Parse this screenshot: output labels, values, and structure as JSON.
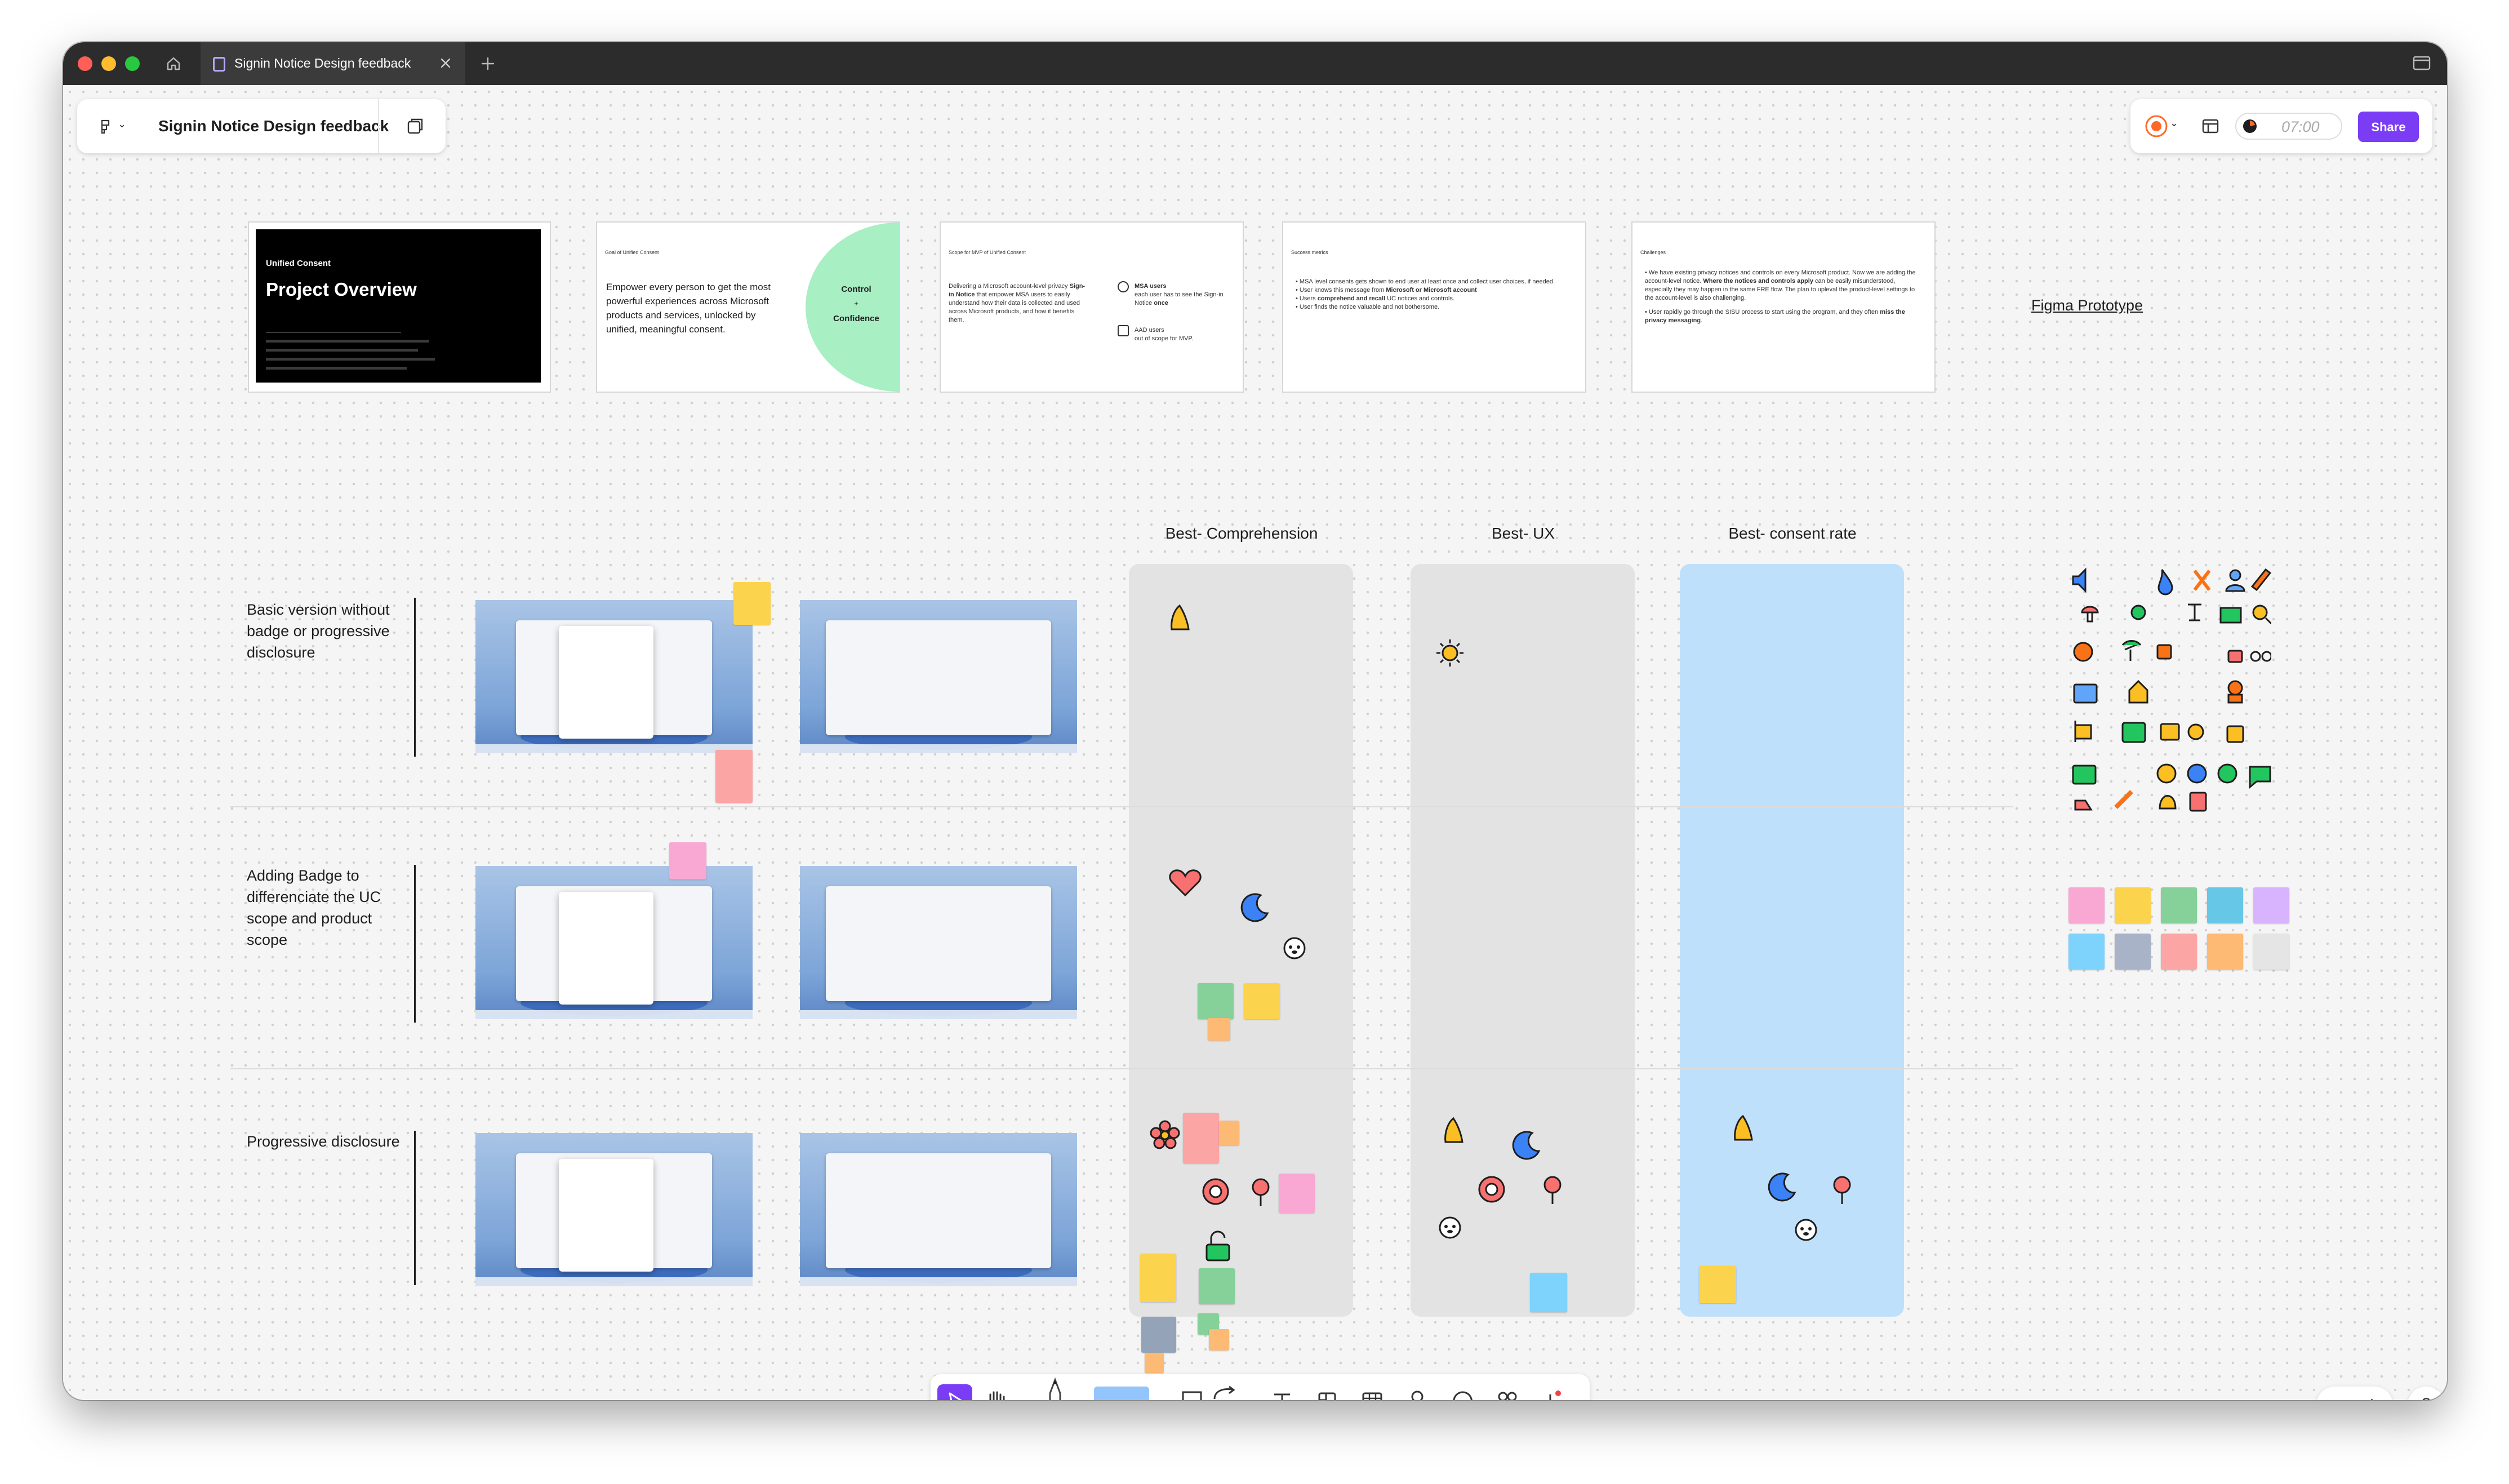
{
  "tab": {
    "title": "Signin Notice Design feedback"
  },
  "file": {
    "name": "Signin Notice Design feedback"
  },
  "header": {
    "timer": "07:00",
    "share_label": "Share"
  },
  "slides": {
    "s1": {
      "eyebrow": "Unified Consent",
      "title": "Project Overview"
    },
    "s2": {
      "heading": "Goal of Unified Consent",
      "body": "Empower every person to get the most powerful experiences across Microsoft products and services, unlocked by unified, meaningful consent.",
      "badge_top": "Control",
      "badge_plus": "+",
      "badge_bottom": "Confidence"
    },
    "s3": {
      "heading": "Scope for MVP of Unified Consent",
      "body_pre": "Delivering a Microsoft account-level privacy ",
      "body_bold": "Sign-in Notice",
      "body_post": " that empower MSA users to easily understand how their data is collected and used across Microsoft products, and how it benefits them.",
      "msa_title": "MSA users",
      "msa_text": "each user has to see the Sign-in Notice",
      "msa_bold": "once",
      "aad_title": "AAD users",
      "aad_text": "out of scope for MVP."
    },
    "s4": {
      "heading": "Success metrics",
      "b1": "MSA level consents gets shown to end user at least once and collect user choices, if needed.",
      "b2_pre": "User knows this message from ",
      "b2_bold": "Microsoft or Microsoft account",
      "b3_pre": "Users ",
      "b3_bold": "comprehend and recall",
      "b3_post": " UC notices and controls.",
      "b4": "User finds the notice valuable and not bothersome."
    },
    "s5": {
      "heading": "Challenges",
      "b1_pre": "We have existing privacy notices and controls on every Microsoft product. Now we are adding the account-level notice. ",
      "b1_bold": "Where the notices and controls apply",
      "b1_post": " can be easily misunderstood, especially they may happen in the same FRE flow. The plan to upleval the product-level settings to the account-level is also challenging.",
      "b2_pre": "User rapidly go through the SISU process to start using the program, and they often ",
      "b2_bold": "miss the privacy messaging",
      "b2_post": "."
    }
  },
  "prototype_link": "Figma Prototype",
  "columns": [
    {
      "label": "Best- Comprehension"
    },
    {
      "label": "Best- UX"
    },
    {
      "label": "Best- consent rate"
    }
  ],
  "rows": [
    {
      "label": "Basic version without badge or progressive disclosure"
    },
    {
      "label": "Adding Badge to differenciate the UC scope and product scope"
    },
    {
      "label": "Progressive disclosure"
    }
  ],
  "colors": {
    "accent": "#7b3cf5",
    "column_grey": "#e3e3e3",
    "column_blue": "#bfe0fb",
    "sticky_yellow": "#fcd34d",
    "sticky_green": "#86d19a",
    "sticky_pink": "#f9a8d4",
    "sticky_red": "#fca5a5",
    "sticky_orange": "#fdba74",
    "sticky_blue": "#7dd3fc",
    "sticky_purple": "#d8b4fe",
    "sticky_gray": "#cbd5e1"
  },
  "toolbar": {
    "tools": [
      "move-tool",
      "hand-tool",
      "pen-tool",
      "sticky-tool",
      "shape-tool",
      "connector-tool",
      "text-tool",
      "section-tool",
      "table-tool",
      "stamp-tool",
      "comment-tool",
      "widget-tool",
      "more-tool"
    ]
  },
  "zoom_controls": {
    "minus": "−",
    "plus": "+",
    "help": "?"
  }
}
